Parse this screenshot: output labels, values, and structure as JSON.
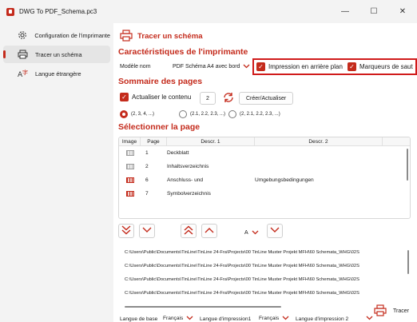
{
  "window": {
    "title": "DWG To PDF_Schema.pc3",
    "minimize_glyph": "—",
    "maximize_glyph": "☐",
    "close_glyph": "✕"
  },
  "sidebar": {
    "items": [
      {
        "label": "Configuration de l'imprimante",
        "icon": "gear-icon",
        "active": false
      },
      {
        "label": "Tracer un schéma",
        "icon": "printer-icon",
        "active": true
      },
      {
        "label": "Langue étrangère",
        "icon": "translate-icon",
        "active": false
      }
    ]
  },
  "main": {
    "page_title": "Tracer un schéma",
    "printer_section": {
      "title": "Caractéristiques de l'imprimante",
      "model_label": "Modèle nom",
      "model_value": "PDF Schéma A4 avec bord",
      "background_print_label": "Impression en arrière plan",
      "background_print_checked": true,
      "jump_markers_label": "Marqueurs de saut",
      "jump_markers_checked": true
    },
    "summary_section": {
      "title": "Sommaire des pages",
      "update_content_label": "Actualiser le contenu",
      "update_content_checked": true,
      "count_value": "2",
      "create_button": "Créer/Actualiser",
      "radio_options": [
        "(2, 3, 4, ...)",
        "(2.1, 2.2, 2.3, ...)",
        "(2, 2.1, 2.2, 2.3, ...)"
      ],
      "radio_selected": 0
    },
    "select_section": {
      "title": "Sélectionner la page",
      "columns": [
        "Image",
        "Page",
        "Descr. 1",
        "Descr. 2"
      ],
      "rows": [
        {
          "page": "1",
          "descr1": "Deckblatt",
          "descr2": ""
        },
        {
          "page": "2",
          "descr1": "Inhaltsverzeichnis",
          "descr2": ""
        },
        {
          "page": "6",
          "descr1": "Anschluss- und",
          "descr2": "Umgebungsbedingungen"
        },
        {
          "page": "7",
          "descr1": "Symbolverzeichnis",
          "descr2": ""
        }
      ],
      "sort_value": "A"
    },
    "paths": [
      "C:\\Users\\Public\\Documents\\TinLine\\TinLine 24-Fra\\Projects\\00 TinLine Muster Projekt MFH\\60 Schemata_WHG\\02S",
      "C:\\Users\\Public\\Documents\\TinLine\\TinLine 24-Fra\\Projects\\00 TinLine Muster Projekt MFH\\60 Schemata_WHG\\02S",
      "C:\\Users\\Public\\Documents\\TinLine\\TinLine 24-Fra\\Projects\\00 TinLine Muster Projekt MFH\\60 Schemata_WHG\\02S",
      "C:\\Users\\Public\\Documents\\TinLine\\TinLine 24-Fra\\Projects\\00 TinLine Muster Projekt MFH\\60 Schemata_WHG\\02S"
    ],
    "languages": {
      "base_label": "Langue de base",
      "base_value": "Français",
      "print1_label": "Langue d'impression1",
      "print1_value": "Français",
      "print2_label": "Langue d'impression 2",
      "print2_value": ""
    },
    "plot_button": "Tracer"
  },
  "colors": {
    "accent": "#c42b1c",
    "highlight_border": "#d01b1b"
  }
}
